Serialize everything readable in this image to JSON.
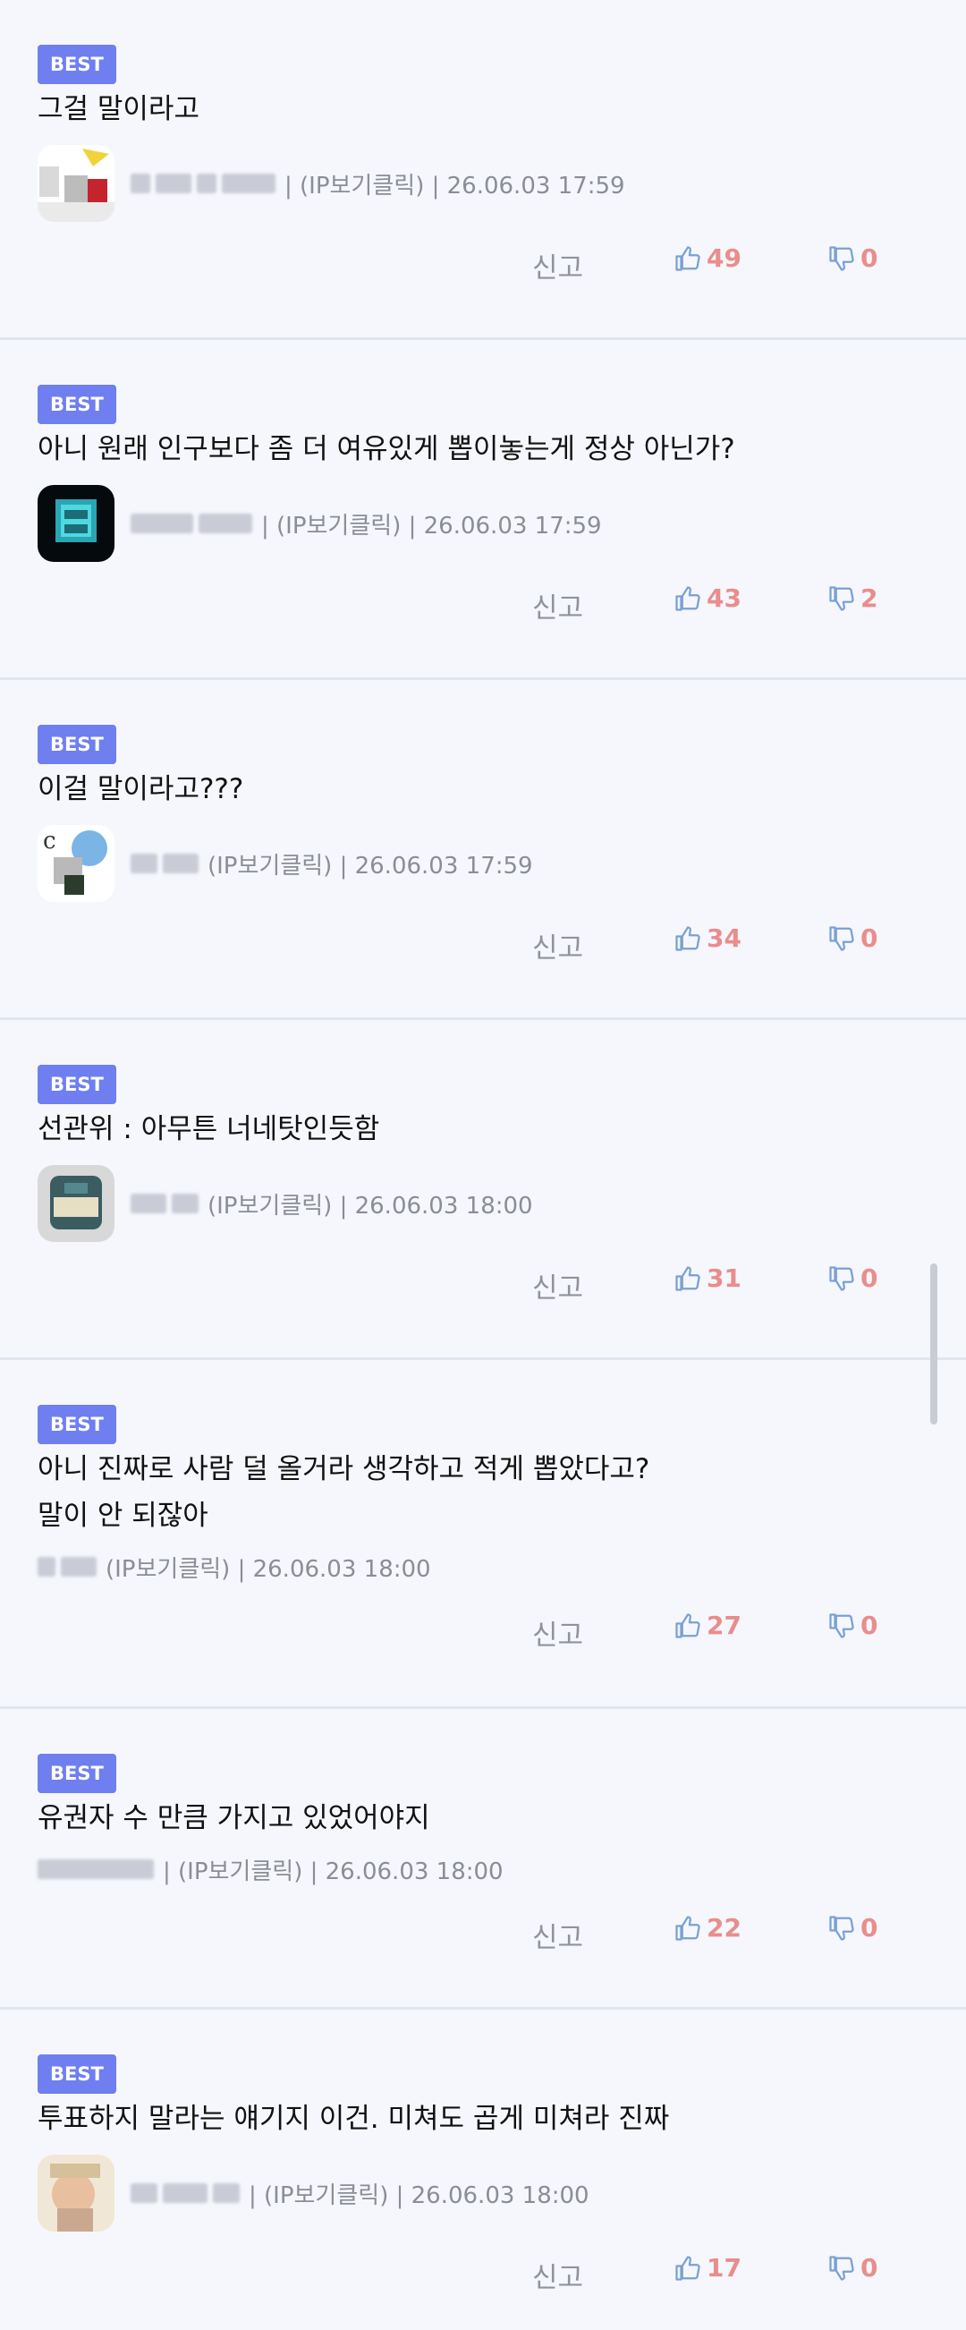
{
  "comments": [
    {
      "badge": "BEST",
      "text": "그걸 말이라고",
      "ip": "| (IP보기클릭) | 26.06.03 17:59",
      "report": "신고",
      "likes": "49",
      "dislikes": "0",
      "avatar": "photo-a"
    },
    {
      "badge": "BEST",
      "text": "아니 원래 인구보다 좀 더 여유있게 뽑이놓는게 정상 아닌가?",
      "ip": "| (IP보기클릭) | 26.06.03 17:59",
      "report": "신고",
      "likes": "43",
      "dislikes": "2",
      "avatar": "photo-b"
    },
    {
      "badge": "BEST",
      "text": "이걸 말이라고???",
      "ip": "(IP보기클릭) | 26.06.03 17:59",
      "report": "신고",
      "likes": "34",
      "dislikes": "0",
      "avatar": "photo-c"
    },
    {
      "badge": "BEST",
      "text": "선관위 : 아무튼 너네탓인듯함",
      "ip": "(IP보기클릭) | 26.06.03 18:00",
      "report": "신고",
      "likes": "31",
      "dislikes": "0",
      "avatar": "photo-d"
    },
    {
      "badge": "BEST",
      "text": "아니 진짜로 사람 덜 올거라 생각하고 적게 뽑았다고?\n말이 안 되잖아",
      "ip": "(IP보기클릭) | 26.06.03 18:00",
      "report": "신고",
      "likes": "27",
      "dislikes": "0",
      "avatar": ""
    },
    {
      "badge": "BEST",
      "text": "유권자 수 만큼 가지고 있었어야지",
      "ip": "| (IP보기클릭) | 26.06.03 18:00",
      "report": "신고",
      "likes": "22",
      "dislikes": "0",
      "avatar": ""
    },
    {
      "badge": "BEST",
      "text": "투표하지 말라는 얘기지 이건. 미쳐도 곱게 미쳐라 진짜",
      "ip": "| (IP보기클릭) | 26.06.03 18:00",
      "report": "신고",
      "likes": "17",
      "dislikes": "0",
      "avatar": "photo-e"
    }
  ],
  "icons": {
    "like": "thumbs-up-icon",
    "dislike": "thumbs-down-icon"
  },
  "colors": {
    "badge": "#6f7ff0",
    "count": "#e98d8d",
    "thumb": "#7aa0d6",
    "meta": "#8a8d96"
  }
}
